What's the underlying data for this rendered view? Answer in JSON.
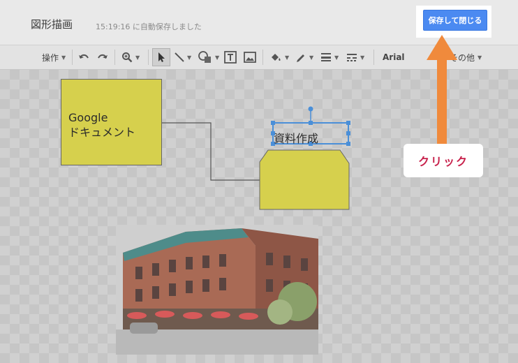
{
  "header": {
    "title": "図形描画",
    "autosave_status": "15:19:16 に自動保存しました",
    "save_close_label": "保存して閉じる"
  },
  "toolbar": {
    "actions_label": "操作",
    "font_label": "Arial",
    "more_label": "その他"
  },
  "canvas": {
    "shape1_text": "Google\nドキュメント",
    "shape2_label": "資料作成"
  },
  "annotation": {
    "click_label": "クリック"
  },
  "colors": {
    "shape_fill": "#d6d04d",
    "accent_button": "#4b8af1",
    "arrow": "#f08a3c",
    "click_text": "#c8234d"
  }
}
